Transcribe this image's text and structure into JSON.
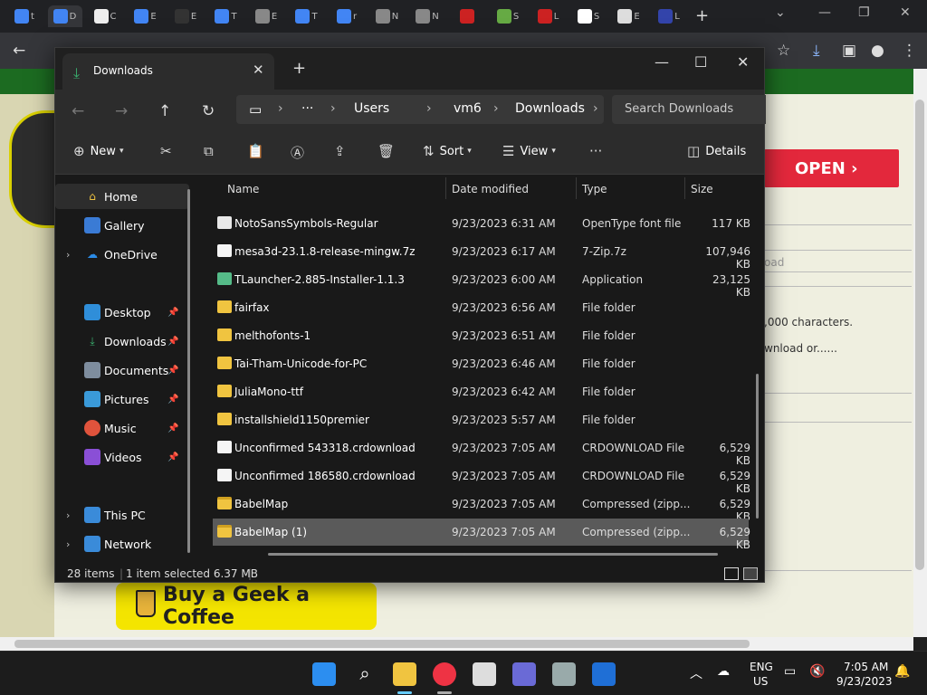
{
  "browser": {
    "tabs": [
      {
        "label": "t",
        "color": "#4285f4"
      },
      {
        "label": "D",
        "color": "#4285f4"
      },
      {
        "label": "C",
        "color": "#eeeeee"
      },
      {
        "label": "E",
        "color": "#4285f4"
      },
      {
        "label": "E",
        "color": "#333333"
      },
      {
        "label": "T",
        "color": "#4285f4"
      },
      {
        "label": "E",
        "color": "#888888"
      },
      {
        "label": "T",
        "color": "#4285f4"
      },
      {
        "label": "r",
        "color": "#4285f4"
      },
      {
        "label": "N",
        "color": "#888888"
      },
      {
        "label": "N",
        "color": "#888888"
      },
      {
        "label": "",
        "color": "#cc2222"
      },
      {
        "label": "S",
        "color": "#66aa44"
      },
      {
        "label": "L",
        "color": "#cc2222"
      },
      {
        "label": "S",
        "color": "#ffffff"
      },
      {
        "label": "E",
        "color": "#dddddd"
      },
      {
        "label": "L",
        "color": "#3344aa"
      }
    ],
    "new_tab": "+"
  },
  "website": {
    "open_button": "OPEN ›",
    "partial_text_1": "oad",
    "partial_text_2": ",000 characters.",
    "partial_text_3": "wnload or......",
    "coffee_button": "Buy a Geek a Coffee"
  },
  "explorer": {
    "tab_title": "Downloads",
    "path": [
      "Users",
      "vm6",
      "Downloads"
    ],
    "search_placeholder": "Search Downloads",
    "toolbar": {
      "new_label": "New",
      "sort_label": "Sort",
      "view_label": "View",
      "details_label": "Details"
    },
    "nav": {
      "home": "Home",
      "gallery": "Gallery",
      "onedrive": "OneDrive",
      "desktop": "Desktop",
      "downloads": "Downloads",
      "documents": "Documents",
      "pictures": "Pictures",
      "music": "Music",
      "videos": "Videos",
      "this_pc": "This PC",
      "network": "Network"
    },
    "columns": {
      "name": "Name",
      "date": "Date modified",
      "type": "Type",
      "size": "Size"
    },
    "files": [
      {
        "name": "NotoSansSymbols-Regular",
        "date": "9/23/2023 6:31 AM",
        "type": "OpenType font file",
        "size": "117 KB",
        "kind": "font"
      },
      {
        "name": "mesa3d-23.1.8-release-mingw.7z",
        "date": "9/23/2023 6:17 AM",
        "type": "7-Zip.7z",
        "size": "107,946 KB",
        "kind": "doc"
      },
      {
        "name": "TLauncher-2.885-Installer-1.1.3",
        "date": "9/23/2023 6:00 AM",
        "type": "Application",
        "size": "23,125 KB",
        "kind": "app"
      },
      {
        "name": "fairfax",
        "date": "9/23/2023 6:56 AM",
        "type": "File folder",
        "size": "",
        "kind": "folder"
      },
      {
        "name": "melthofonts-1",
        "date": "9/23/2023 6:51 AM",
        "type": "File folder",
        "size": "",
        "kind": "folder"
      },
      {
        "name": "Tai-Tham-Unicode-for-PC",
        "date": "9/23/2023 6:46 AM",
        "type": "File folder",
        "size": "",
        "kind": "folder"
      },
      {
        "name": "JuliaMono-ttf",
        "date": "9/23/2023 6:42 AM",
        "type": "File folder",
        "size": "",
        "kind": "folder"
      },
      {
        "name": "installshield1150premier",
        "date": "9/23/2023 5:57 AM",
        "type": "File folder",
        "size": "",
        "kind": "folder"
      },
      {
        "name": "Unconfirmed 543318.crdownload",
        "date": "9/23/2023 7:05 AM",
        "type": "CRDOWNLOAD File",
        "size": "6,529 KB",
        "kind": "doc"
      },
      {
        "name": "Unconfirmed 186580.crdownload",
        "date": "9/23/2023 7:05 AM",
        "type": "CRDOWNLOAD File",
        "size": "6,529 KB",
        "kind": "doc"
      },
      {
        "name": "BabelMap",
        "date": "9/23/2023 7:05 AM",
        "type": "Compressed (zipp...",
        "size": "6,529 KB",
        "kind": "zip"
      },
      {
        "name": "BabelMap (1)",
        "date": "9/23/2023 7:05 AM",
        "type": "Compressed (zipp...",
        "size": "6,529 KB",
        "kind": "zip",
        "selected": true
      }
    ],
    "status": {
      "items": "28 items",
      "selection": "1 item selected  6.37 MB"
    }
  },
  "taskbar": {
    "lang_1": "ENG",
    "lang_2": "US",
    "time": "7:05 AM",
    "date": "9/23/2023"
  }
}
